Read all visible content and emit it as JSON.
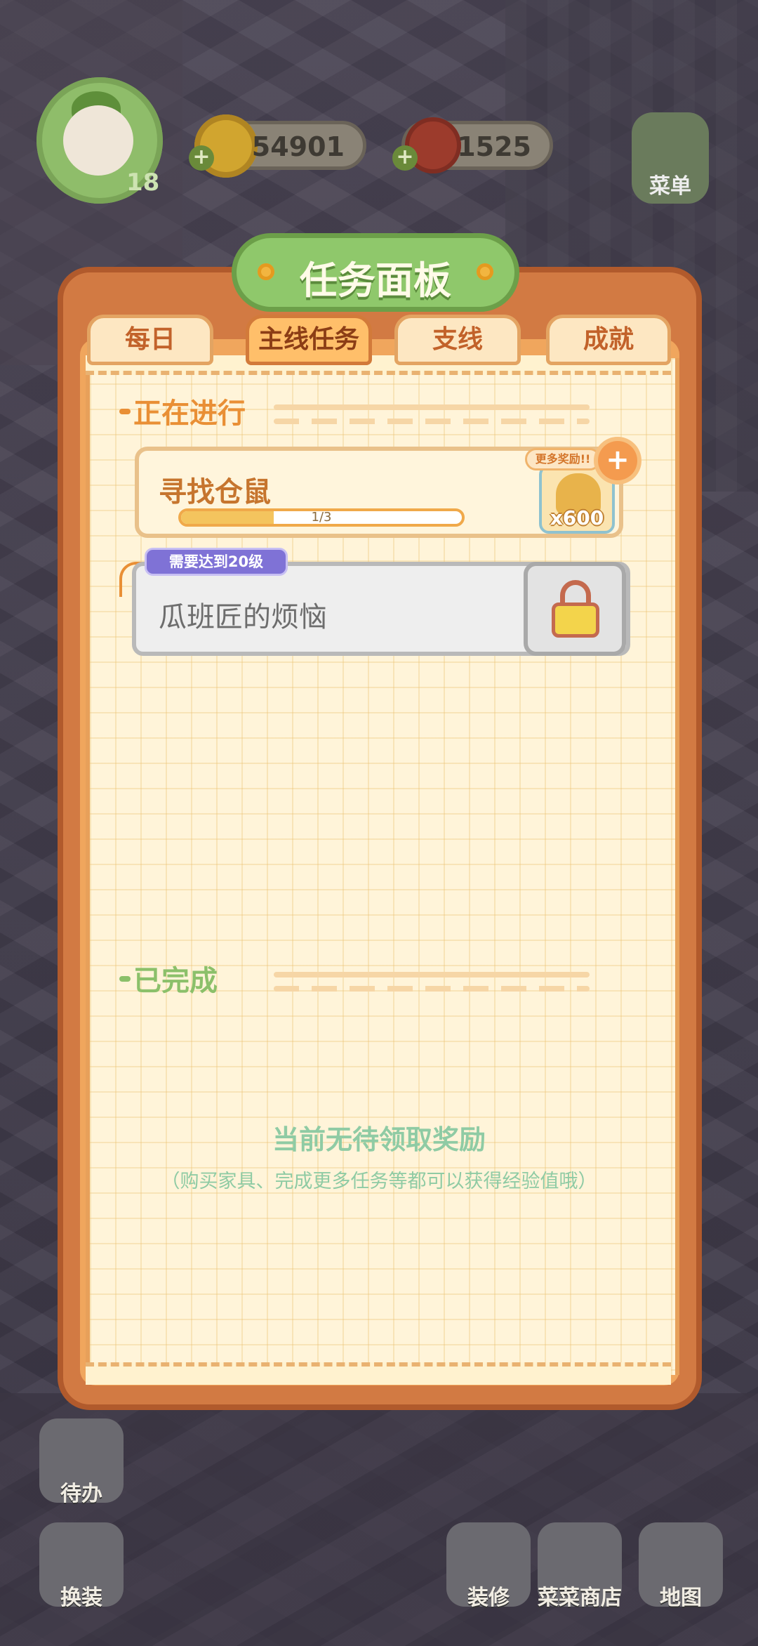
{
  "hud": {
    "player_level": "18",
    "coins": "54901",
    "veggies": "1525",
    "menu_label": "菜单"
  },
  "panel": {
    "title": "任务面板",
    "tabs": [
      {
        "label": "每日",
        "active": false
      },
      {
        "label": "主线任务",
        "active": true
      },
      {
        "label": "支线",
        "active": false
      },
      {
        "label": "成就",
        "active": false
      }
    ],
    "ongoing_header": "正在进行",
    "quests": [
      {
        "title": "寻找仓鼠",
        "progress_text": "1/3",
        "progress": 0.33,
        "reward_qty": "x600",
        "more_reward": "更多奖励!!"
      }
    ],
    "locked_quest": {
      "title": "瓜班匠的烦恼",
      "requirement": "需要达到20级"
    },
    "completed_header": "已完成",
    "empty_title": "当前无待领取奖励",
    "empty_subtitle": "（购买家具、完成更多任务等都可以获得经验值哦）"
  },
  "bottom": {
    "todo": "待办",
    "dress": "换装",
    "decorate": "装修",
    "shop": "菜菜商店",
    "map": "地图"
  },
  "colors": {
    "accent_orange": "#e98f35",
    "accent_green": "#8bc06a"
  }
}
